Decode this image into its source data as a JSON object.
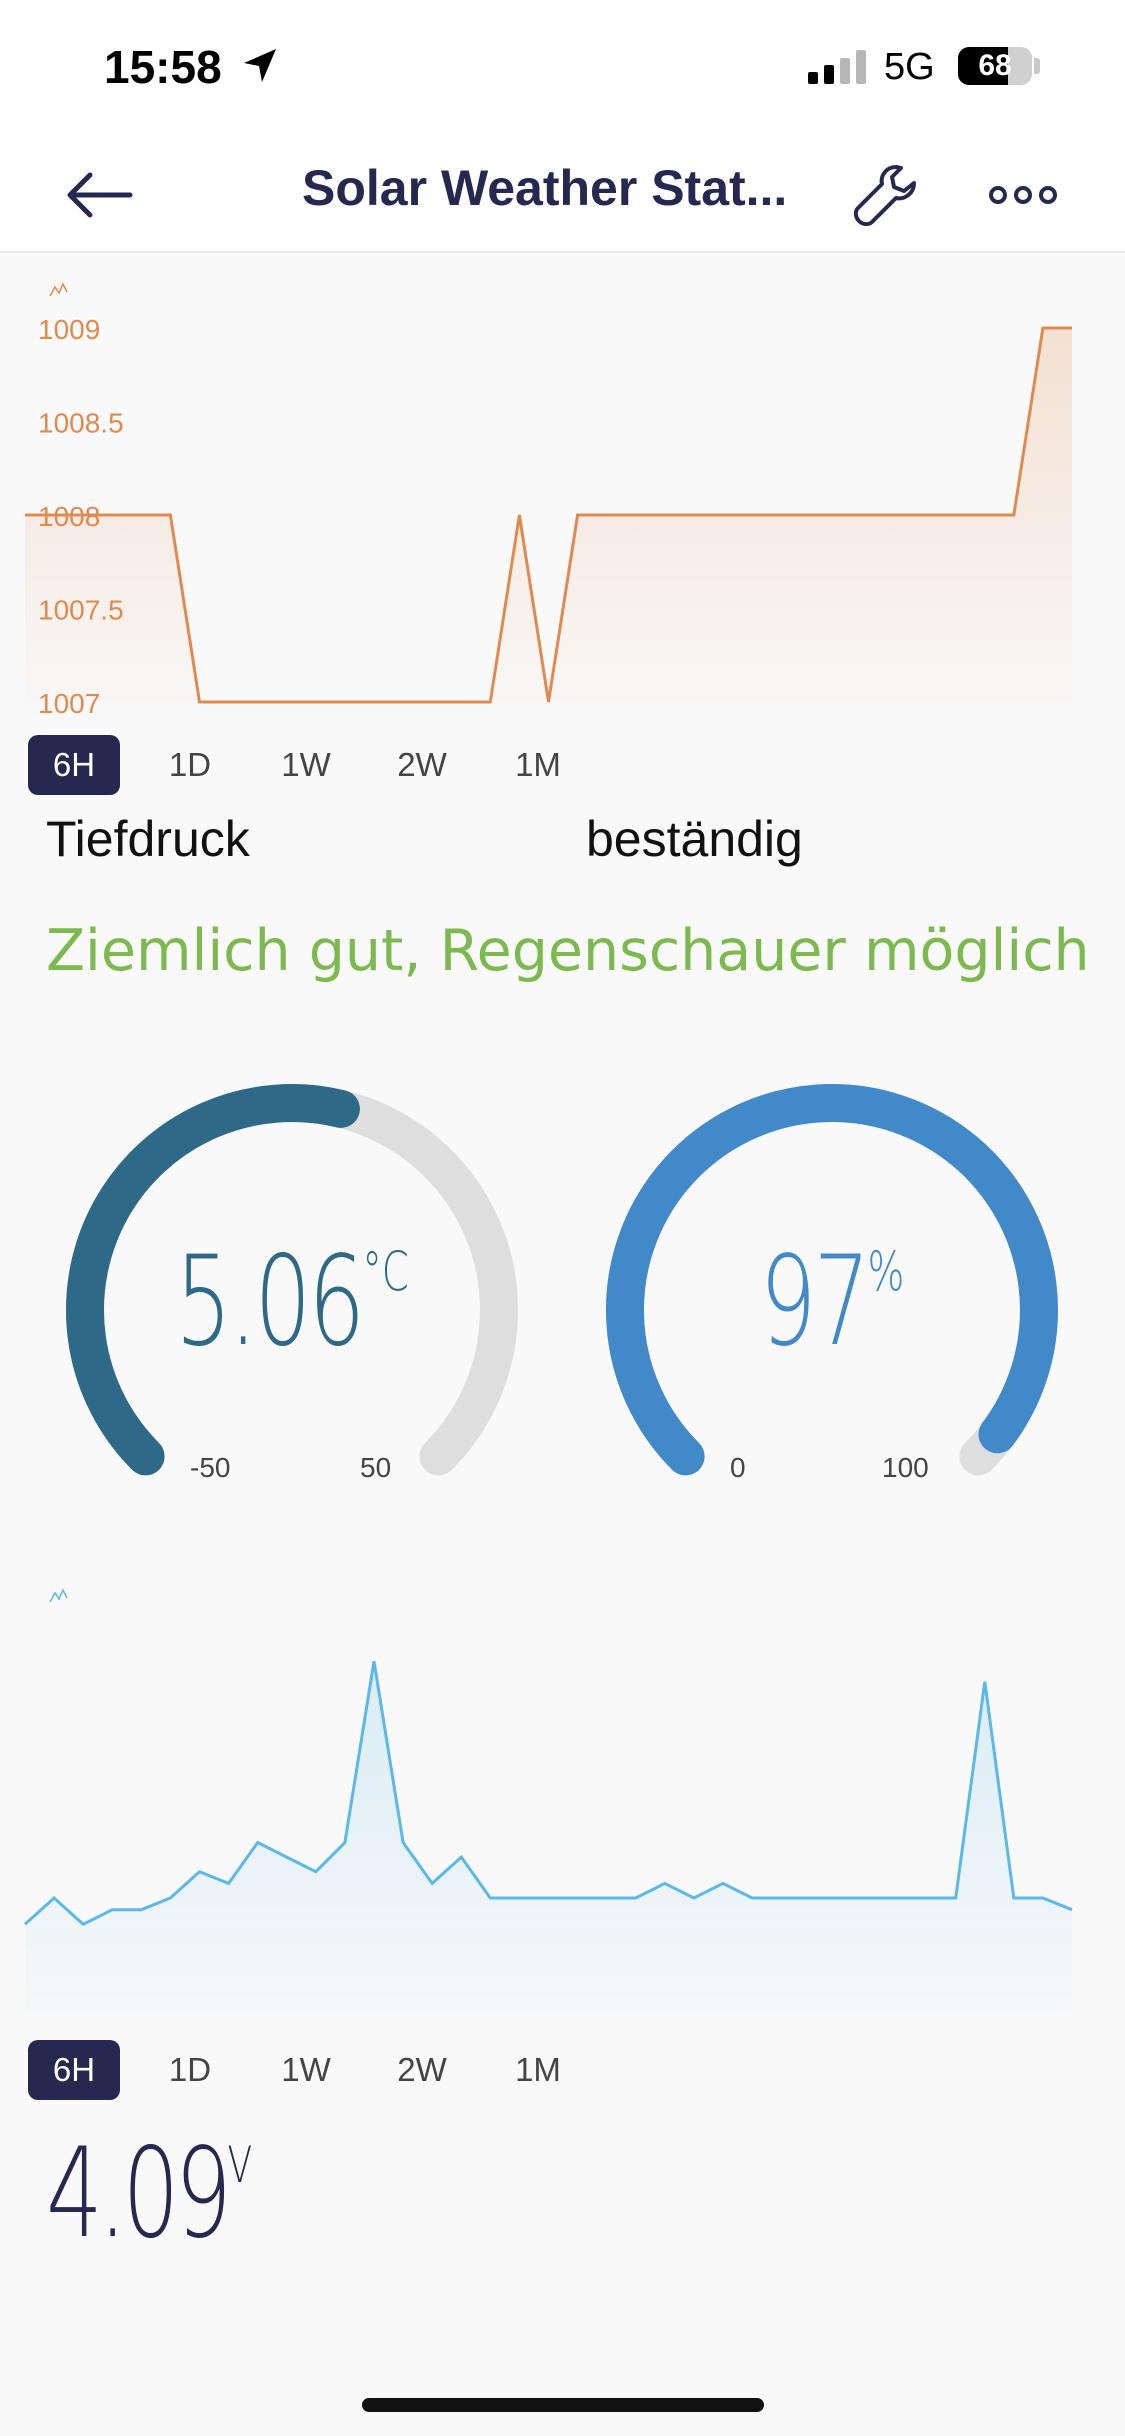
{
  "status_bar": {
    "time": "15:58",
    "network": "5G",
    "battery_level": "68",
    "icons": [
      "location-arrow-icon",
      "cellular-signal-icon",
      "battery-icon"
    ]
  },
  "nav": {
    "title": "Solar Weather Stat...",
    "icons": [
      "back-arrow-icon",
      "wrench-icon",
      "more-dots-icon"
    ]
  },
  "pressure_chart": {
    "y_ticks": [
      "1009",
      "1008.5",
      "1008",
      "1007.5",
      "1007"
    ],
    "tabs": [
      "6H",
      "1D",
      "1W",
      "2W",
      "1M"
    ],
    "active_tab": "6H",
    "color": "#e08a4f"
  },
  "pressure_status": {
    "trend_left": "Tiefdruck",
    "trend_right": "beständig"
  },
  "forecast": {
    "text": "Ziemlich gut, Regenschauer möglich",
    "color": "#7cb94f"
  },
  "temperature_gauge": {
    "value": "5.06",
    "unit": "°C",
    "min": "-50",
    "max": "50",
    "color": "#2e6a88"
  },
  "humidity_gauge": {
    "value": "97",
    "unit": "%",
    "min": "0",
    "max": "100",
    "color": "#4189c8"
  },
  "voltage_chart": {
    "tabs": [
      "6H",
      "1D",
      "1W",
      "2W",
      "1M"
    ],
    "active_tab": "6H",
    "color": "#5bb8e8"
  },
  "voltage": {
    "value": "4.09",
    "unit": "V"
  },
  "chart_data": [
    {
      "type": "area",
      "ylim": [
        1007,
        1009
      ],
      "y_ticks": [
        1009,
        1008.5,
        1008,
        1007.5,
        1007
      ],
      "values": [
        1008,
        1008,
        1008,
        1008,
        1008,
        1008,
        1007,
        1007,
        1007,
        1007,
        1007,
        1007,
        1007,
        1007,
        1007,
        1007,
        1007,
        1008,
        1007,
        1008,
        1008,
        1008,
        1008,
        1008,
        1008,
        1008,
        1008,
        1008,
        1008,
        1008,
        1008,
        1008,
        1008,
        1008,
        1008,
        1009,
        1009
      ]
    },
    {
      "type": "area",
      "values": [
        4.0,
        4.09,
        4.0,
        4.05,
        4.05,
        4.09,
        4.18,
        4.14,
        4.28,
        4.23,
        4.18,
        4.28,
        4.9,
        4.28,
        4.14,
        4.23,
        4.09,
        4.09,
        4.09,
        4.09,
        4.09,
        4.09,
        4.14,
        4.09,
        4.14,
        4.09,
        4.09,
        4.09,
        4.09,
        4.09,
        4.09,
        4.09,
        4.09,
        4.83,
        4.09,
        4.09,
        4.05
      ]
    }
  ]
}
